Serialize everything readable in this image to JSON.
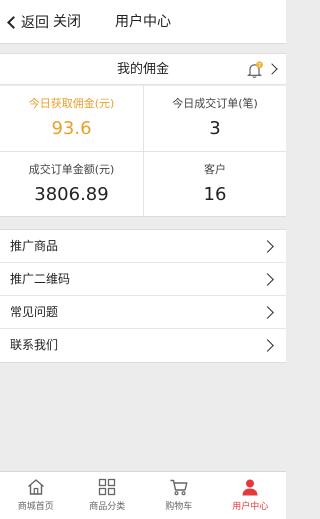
{
  "topbar": {
    "back_label": "返回",
    "close_label": "关闭",
    "title": "用户中心"
  },
  "commission": {
    "title": "我的佣金",
    "notification_icon": "bell-icon",
    "notification_badge": "?"
  },
  "stats": [
    {
      "label": "今日获取佣金(元)",
      "value": "93.6",
      "color": "#e8a02a"
    },
    {
      "label": "今日成交订单(笔)",
      "value": "3"
    },
    {
      "label": "成交订单金额(元)",
      "value": "3806.89"
    },
    {
      "label": "客户",
      "value": "16"
    }
  ],
  "menu": [
    {
      "label": "推广商品"
    },
    {
      "label": "推广二维码"
    },
    {
      "label": "常见问题"
    },
    {
      "label": "联系我们"
    }
  ],
  "tabbar": {
    "active_color": "#e4393c",
    "items": [
      {
        "label": "商城首页",
        "icon": "home-icon"
      },
      {
        "label": "商品分类",
        "icon": "grid-icon"
      },
      {
        "label": "购物车",
        "icon": "cart-icon"
      },
      {
        "label": "用户中心",
        "icon": "user-icon",
        "active": true
      }
    ]
  }
}
